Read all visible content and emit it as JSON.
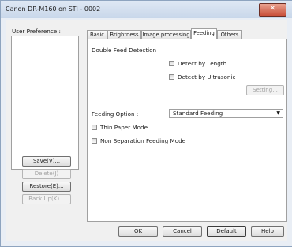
{
  "window": {
    "title": "Canon DR-M160 on STI - 0002",
    "close_label": "✕"
  },
  "sidebar": {
    "user_preference_label": "User Preference :",
    "buttons": {
      "save": "Save(V)...",
      "delete": "Delete(J)",
      "restore": "Restore(E)...",
      "backup": "Back Up(K)..."
    }
  },
  "tabs": [
    "Basic",
    "Brightness",
    "Image processing",
    "Feeding",
    "Others"
  ],
  "feeding": {
    "double_feed_label": "Double Feed Detection :",
    "detect_by_length": "Detect by Length",
    "detect_by_ultrasonic": "Detect by Ultrasonic",
    "setting_button": "Setting...",
    "feeding_option_label": "Feeding Option :",
    "feeding_option_value": "Standard Feeding",
    "thin_paper_mode": "Thin Paper Mode",
    "non_separation_mode": "Non Separation Feeding Mode"
  },
  "footer": {
    "ok": "OK",
    "cancel": "Cancel",
    "default": "Default",
    "help": "Help"
  }
}
